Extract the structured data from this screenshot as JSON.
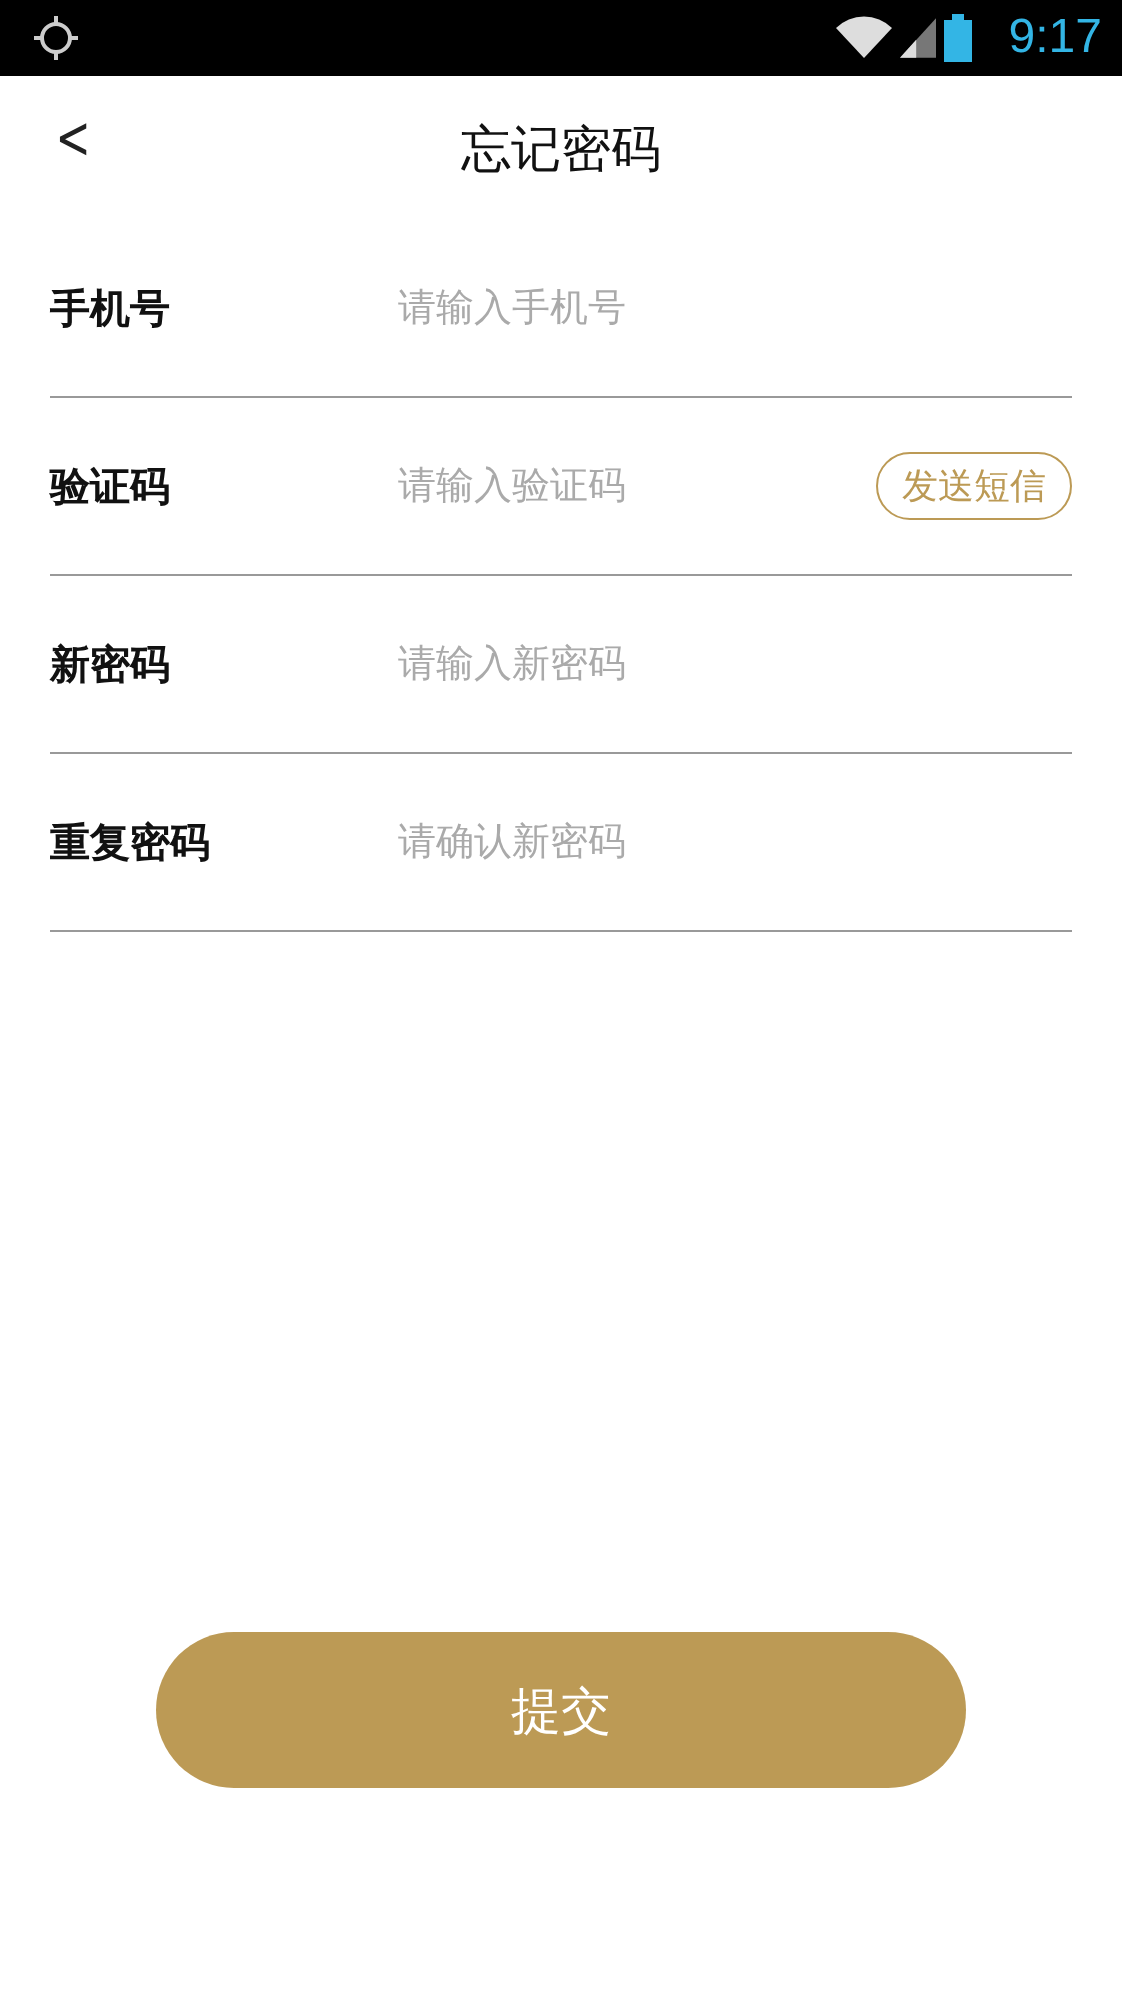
{
  "status_bar": {
    "time": "9:17"
  },
  "header": {
    "back": "<",
    "title": "忘记密码"
  },
  "form": {
    "fields": [
      {
        "kind": "text",
        "label": "手机号",
        "placeholder": "请输入手机号"
      },
      {
        "kind": "code",
        "label": "验证码",
        "placeholder": "请输入验证码",
        "action": "发送短信"
      },
      {
        "kind": "password",
        "label": "新密码",
        "placeholder": "请输入新密码"
      },
      {
        "kind": "password",
        "label": "重复密码",
        "placeholder": "请确认新密码"
      }
    ]
  },
  "submit": "提交"
}
